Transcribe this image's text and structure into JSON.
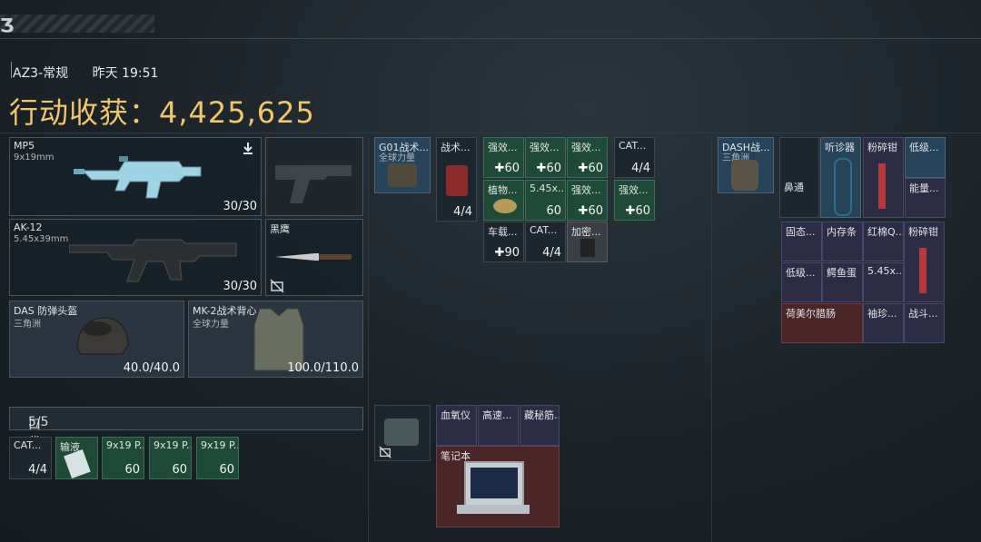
{
  "header": {
    "mode": "AZ3-常规",
    "time": "昨天 19:51",
    "earnings_label": "行动收获：",
    "earnings_value": "4,425,625",
    "logo": "Ʒ"
  },
  "weapons": [
    {
      "name": "MP5",
      "caliber": "9x19mm",
      "ammo": "30/30"
    },
    {
      "name": "AK-12",
      "caliber": "5.45x39mm",
      "ammo": "30/30"
    }
  ],
  "melee": {
    "name": "黑鹰"
  },
  "armor": [
    {
      "name": "DAS 防弹头盔",
      "brand": "三角洲",
      "durability": "40.0/40.0"
    },
    {
      "name": "MK-2战术背心",
      "brand": "全球力量",
      "durability": "100.0/110.0"
    }
  ],
  "pocket": {
    "label": "口袋：",
    "value": "5/5",
    "items": [
      {
        "name": "CAT...",
        "count": "4/4"
      },
      {
        "name": "输液",
        "count": ""
      },
      {
        "name": "9x19 P...",
        "count": "60"
      },
      {
        "name": "9x19 P...",
        "count": "60"
      },
      {
        "name": "9x19 P...",
        "count": "60"
      }
    ]
  },
  "rig": {
    "name": "G01战术...",
    "brand": "全球力量",
    "items": [
      {
        "name": "战术...",
        "count": "4/4"
      },
      {
        "name": "强效...",
        "count": "60"
      },
      {
        "name": "强效...",
        "count": "60"
      },
      {
        "name": "强效...",
        "count": "60"
      },
      {
        "name": "CAT...",
        "count": "4/4"
      },
      {
        "name": "植物...",
        "count": ""
      },
      {
        "name": "5.45x...",
        "count": "60"
      },
      {
        "name": "强效...",
        "count": "60"
      },
      {
        "name": "强效...",
        "count": "60"
      },
      {
        "name": "车载...",
        "count": "90"
      },
      {
        "name": "CAT...",
        "count": "4/4"
      },
      {
        "name": "加密...",
        "count": ""
      }
    ]
  },
  "case": {
    "items": [
      {
        "name": "血氧仪"
      },
      {
        "name": "高速..."
      },
      {
        "name": "藏秘筋..."
      },
      {
        "name": "笔记本"
      }
    ]
  },
  "backpack": {
    "name": "DASH战...",
    "brand": "三角洲",
    "items": [
      {
        "name": "听诊器"
      },
      {
        "name": "粉碎钳"
      },
      {
        "name": "低级..."
      },
      {
        "name": "鼻通"
      },
      {
        "name": "能量..."
      },
      {
        "name": "固态..."
      },
      {
        "name": "内存条"
      },
      {
        "name": "红棉Q..."
      },
      {
        "name": "粉碎钳"
      },
      {
        "name": "低级..."
      },
      {
        "name": "鳄鱼蛋"
      },
      {
        "name": "5.45x..."
      },
      {
        "name": "荷美尔腊肠"
      },
      {
        "name": "袖珍..."
      },
      {
        "name": "战斗..."
      }
    ]
  }
}
